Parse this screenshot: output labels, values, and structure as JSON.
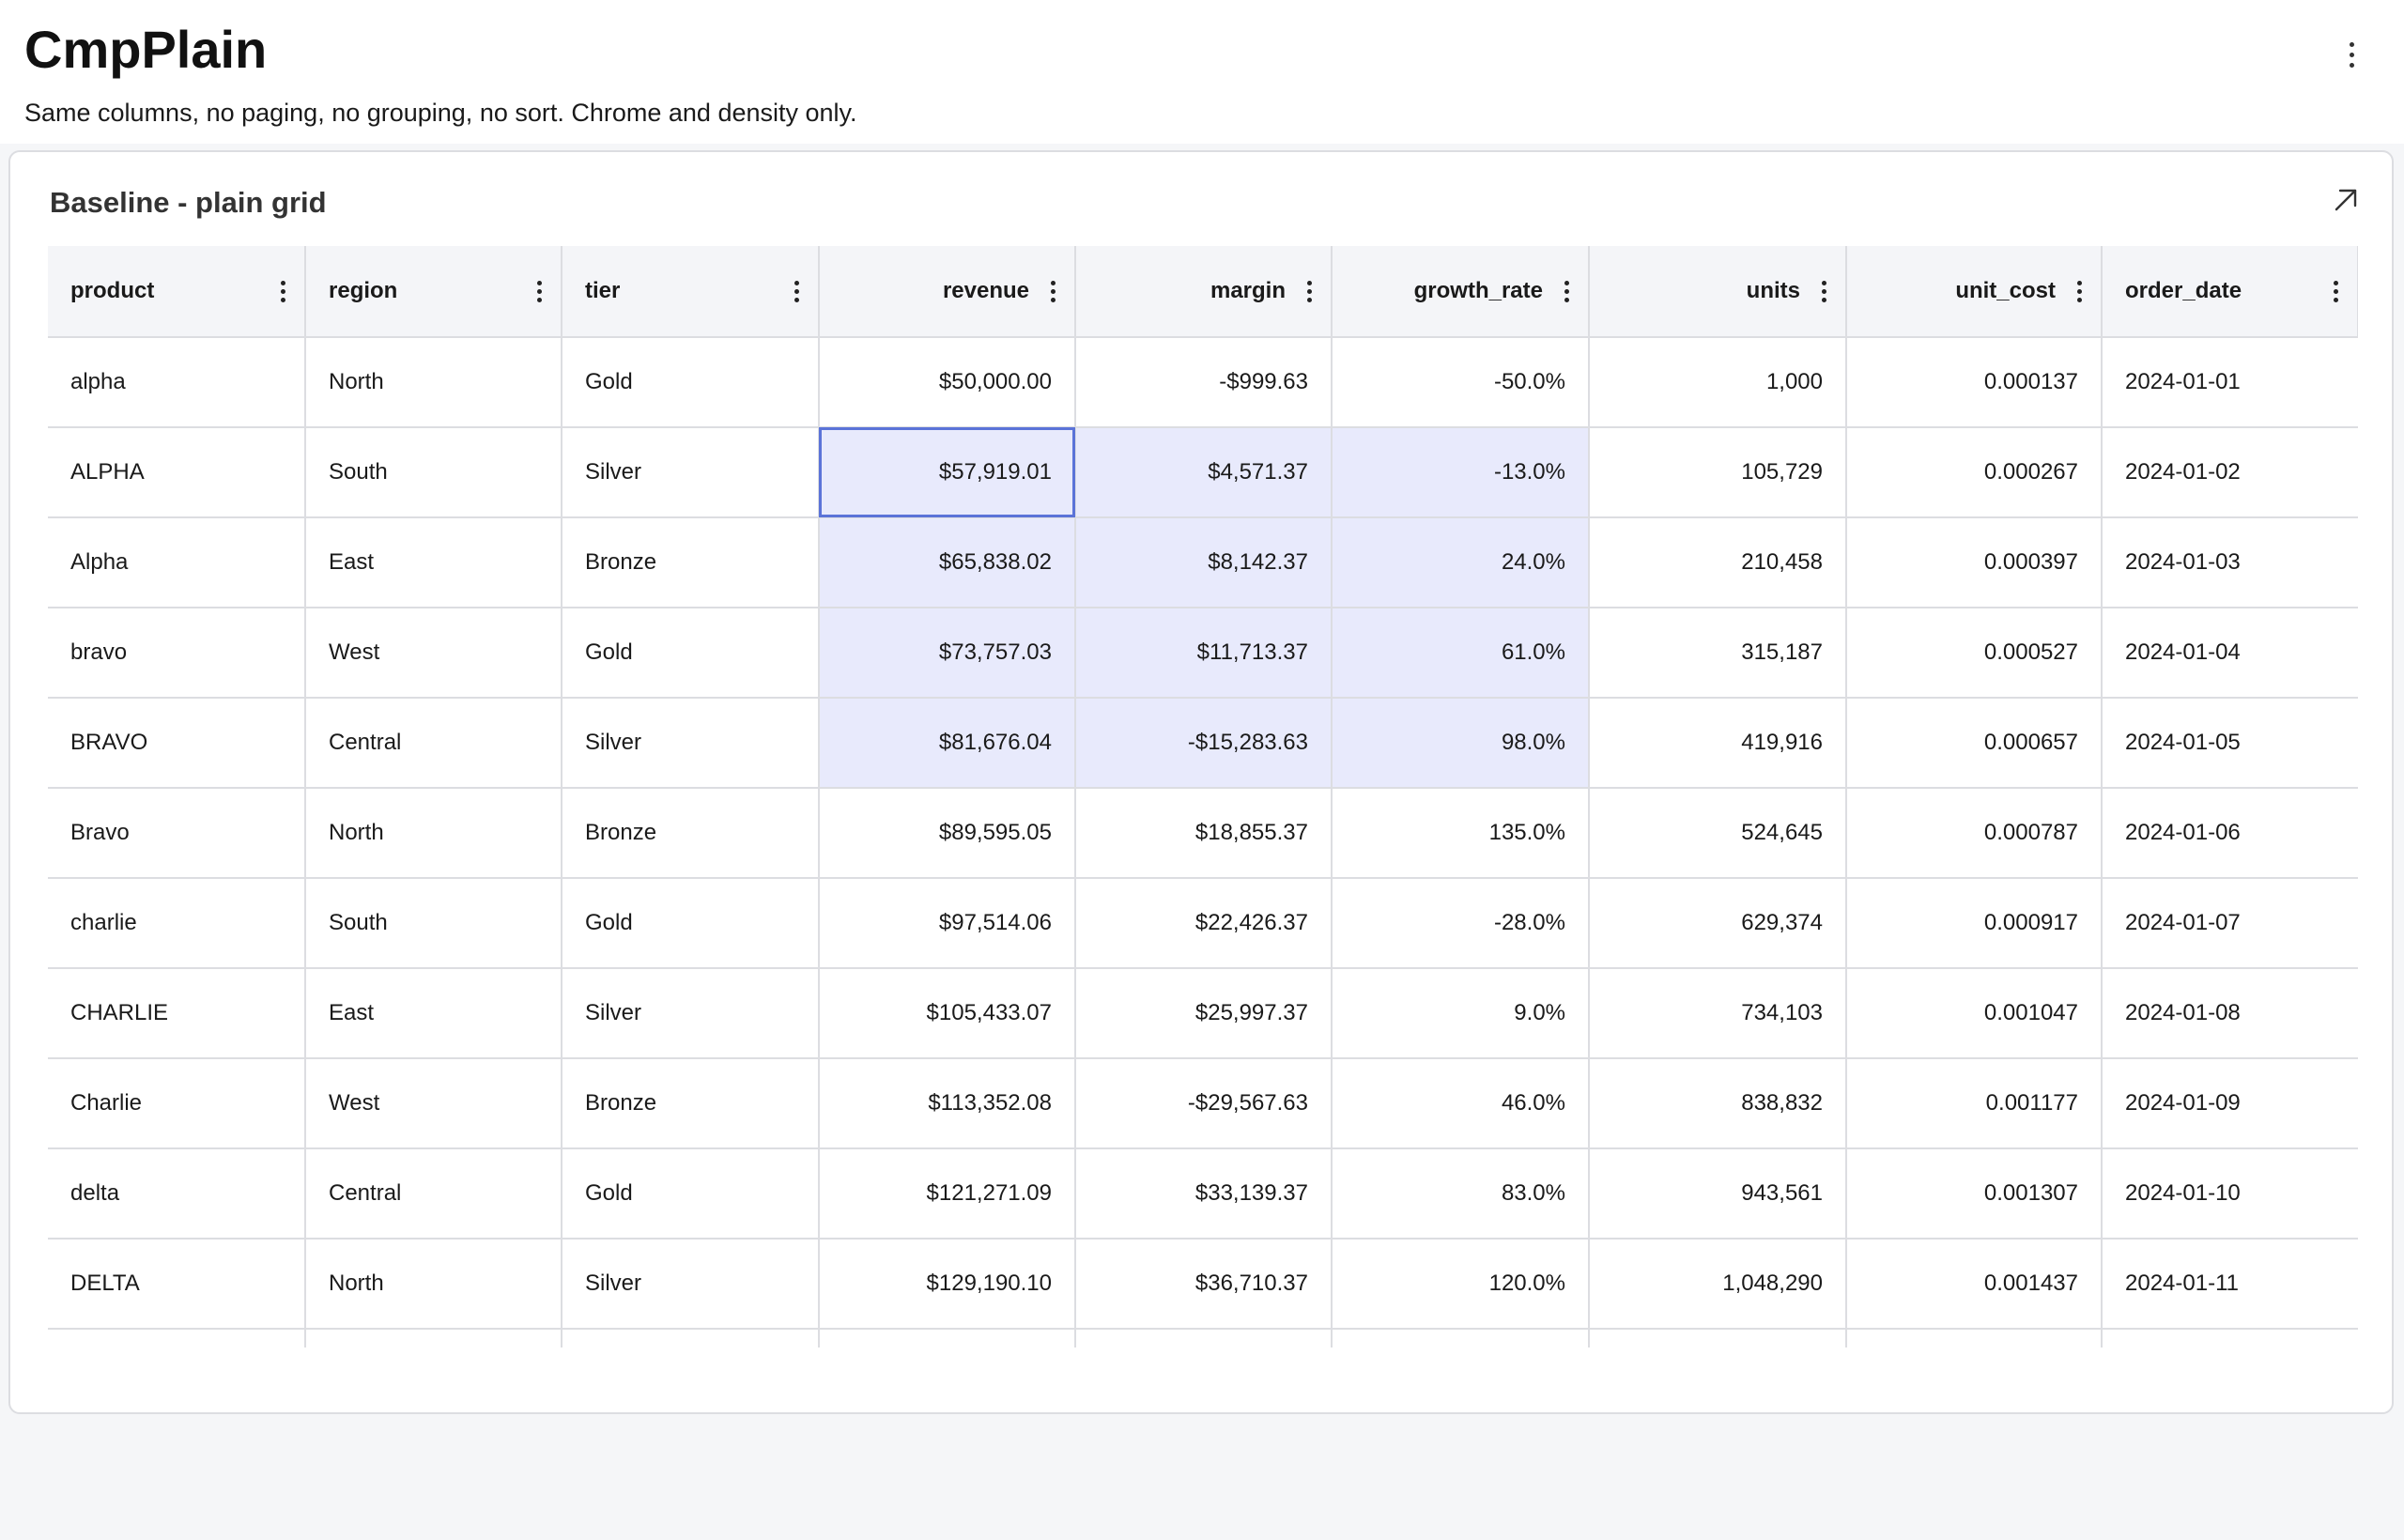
{
  "page": {
    "title": "CmpPlain",
    "subtitle": "Same columns, no paging, no grouping, no sort. Chrome and density only."
  },
  "card": {
    "title": "Baseline - plain grid"
  },
  "icons": {
    "page_menu": "more-vertical-icon",
    "expand": "arrow-up-right-icon",
    "column_menu": "more-vertical-icon"
  },
  "colors": {
    "selection_fill": "#e8eafc",
    "focus_outline": "#5b73d8",
    "header_bg": "#f4f5f8"
  },
  "grid": {
    "columns": [
      "product",
      "region",
      "tier",
      "revenue",
      "margin",
      "growth_rate",
      "units",
      "unit_cost",
      "order_date"
    ],
    "rows": [
      [
        "alpha",
        "North",
        "Gold",
        "$50,000.00",
        "-$999.63",
        "-50.0%",
        "1,000",
        "0.000137",
        "2024-01-01"
      ],
      [
        "ALPHA",
        "South",
        "Silver",
        "$57,919.01",
        "$4,571.37",
        "-13.0%",
        "105,729",
        "0.000267",
        "2024-01-02"
      ],
      [
        "Alpha",
        "East",
        "Bronze",
        "$65,838.02",
        "$8,142.37",
        "24.0%",
        "210,458",
        "0.000397",
        "2024-01-03"
      ],
      [
        "bravo",
        "West",
        "Gold",
        "$73,757.03",
        "$11,713.37",
        "61.0%",
        "315,187",
        "0.000527",
        "2024-01-04"
      ],
      [
        "BRAVO",
        "Central",
        "Silver",
        "$81,676.04",
        "-$15,283.63",
        "98.0%",
        "419,916",
        "0.000657",
        "2024-01-05"
      ],
      [
        "Bravo",
        "North",
        "Bronze",
        "$89,595.05",
        "$18,855.37",
        "135.0%",
        "524,645",
        "0.000787",
        "2024-01-06"
      ],
      [
        "charlie",
        "South",
        "Gold",
        "$97,514.06",
        "$22,426.37",
        "-28.0%",
        "629,374",
        "0.000917",
        "2024-01-07"
      ],
      [
        "CHARLIE",
        "East",
        "Silver",
        "$105,433.07",
        "$25,997.37",
        "9.0%",
        "734,103",
        "0.001047",
        "2024-01-08"
      ],
      [
        "Charlie",
        "West",
        "Bronze",
        "$113,352.08",
        "-$29,567.63",
        "46.0%",
        "838,832",
        "0.001177",
        "2024-01-09"
      ],
      [
        "delta",
        "Central",
        "Gold",
        "$121,271.09",
        "$33,139.37",
        "83.0%",
        "943,561",
        "0.001307",
        "2024-01-10"
      ],
      [
        "DELTA",
        "North",
        "Silver",
        "$129,190.10",
        "$36,710.37",
        "120.0%",
        "1,048,290",
        "0.001437",
        "2024-01-11"
      ]
    ]
  }
}
